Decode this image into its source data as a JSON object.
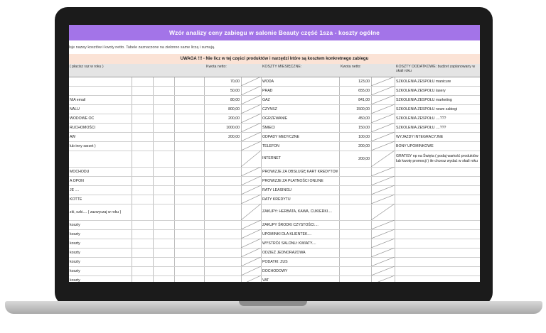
{
  "title": "Wzór analizy ceny zabiegu w salonie Beauty    część 1sza -  koszty ogólne",
  "instruction": "lsje nazwy kosztów i kwoty netto. Tabele zaznaczone na zielonno same liczą i sumują.",
  "warning": "UWAGA !!! - Nie licz w tej części produktów i narzędzi które są kosztem konkretnego zabiegu",
  "headers": {
    "col1": "( płacisz raz w roku )",
    "col5": "Kwota netto:",
    "col7": "KOSZTY MIESIĘCZNE:",
    "col8": "Kwota netto:",
    "col10": "KOSZTY DODATKOWE: budżet zaplanowany w skali roku"
  },
  "rows": [
    {
      "a": "",
      "b": "70,00",
      "c": "WODA",
      "d": "123,00",
      "e": "SZKOLENIA ZESPOŁU manicure"
    },
    {
      "a": "",
      "b": "50,00",
      "c": "PRĄD",
      "d": "655,00",
      "e": "SZKOLENIA ZESPOŁU lasery"
    },
    {
      "a": "NIA email",
      "b": "80,00",
      "c": "GAZ",
      "d": "841,00",
      "e": "SZKOLENIA ZESPOŁU marketing"
    },
    {
      "a": "NALU",
      "b": "800,00",
      "c": "CZYNSZ",
      "d": "1500,00",
      "e": "SZKOLENIA ZESPOŁU nowe zabiegi"
    },
    {
      "a": "WODOWE OC",
      "b": "200,00",
      "c": "OGRZEWANIE",
      "d": "450,00",
      "e": "SZKOLENIA ZESPOŁU ....???"
    },
    {
      "a": "RUCHOMOŚCI",
      "b": "1000,00",
      "c": "ŚMIECI",
      "d": "150,00",
      "e": "SZKOLENIA ZESPOŁU ....???"
    },
    {
      "a": "AW",
      "b": "200,00",
      "c": "ODPADY MEDYCZNE",
      "d": "100,00",
      "e": "WYJAZDY INTEGRACYJNE"
    },
    {
      "a": "lub inny sarzet )",
      "b": "",
      "c": "TELEFON",
      "d": "200,00",
      "e": "BONY UPOMINKOWE"
    },
    {
      "a": "",
      "b": "",
      "c": "INTERNET",
      "d": "200,00",
      "e": "GRATISY np na Święta ( podaj wartość produktów lub kwotę promocji ) ile chcesz wydać w skali roku"
    },
    {
      "a": "MOCHODU",
      "b": "",
      "c": "PROWIZJE ZA OBSŁUGĘ KART KREDYTOWYCH",
      "d": "",
      "e": ""
    },
    {
      "a": "A OPON",
      "b": "",
      "c": "PROWIZJE ZA PŁATNOŚCI ONLINE",
      "d": "",
      "e": ""
    },
    {
      "a": "JE ....",
      "b": "",
      "c": "RATY LEASINGU",
      "d": "",
      "e": ""
    },
    {
      "a": "KOTTE",
      "b": "",
      "c": "RATY KREDYTU",
      "d": "",
      "e": ""
    },
    {
      "a": "zki, ozki.... ( zazwyczaj w roku )",
      "b": "",
      "c": "ZAKUPY: HERBATA, KAWA, CUKIERKI....",
      "d": "",
      "e": ""
    },
    {
      "a": "koszty",
      "b": "",
      "c": "ZAKUPY ŚRODKI CZYSTOŚCI....",
      "d": "",
      "e": ""
    },
    {
      "a": "koszty",
      "b": "",
      "c": "UPOMINKI DLA KLIENTEK....",
      "d": "",
      "e": ""
    },
    {
      "a": "koszty",
      "b": "",
      "c": "WYSTRÓJ SALONU: KWIATY....",
      "d": "",
      "e": ""
    },
    {
      "a": "koszty",
      "b": "",
      "c": "ODZIEŻ JEDNORAZOWA",
      "d": "",
      "e": ""
    },
    {
      "a": "koszty",
      "b": "",
      "c": "PODATKI: ZUS",
      "d": "",
      "e": ""
    },
    {
      "a": "koszty",
      "b": "",
      "c": "DOCHODOWY",
      "d": "",
      "e": ""
    },
    {
      "a": "koszty",
      "b": "",
      "c": "VAT",
      "d": "",
      "e": ""
    }
  ]
}
